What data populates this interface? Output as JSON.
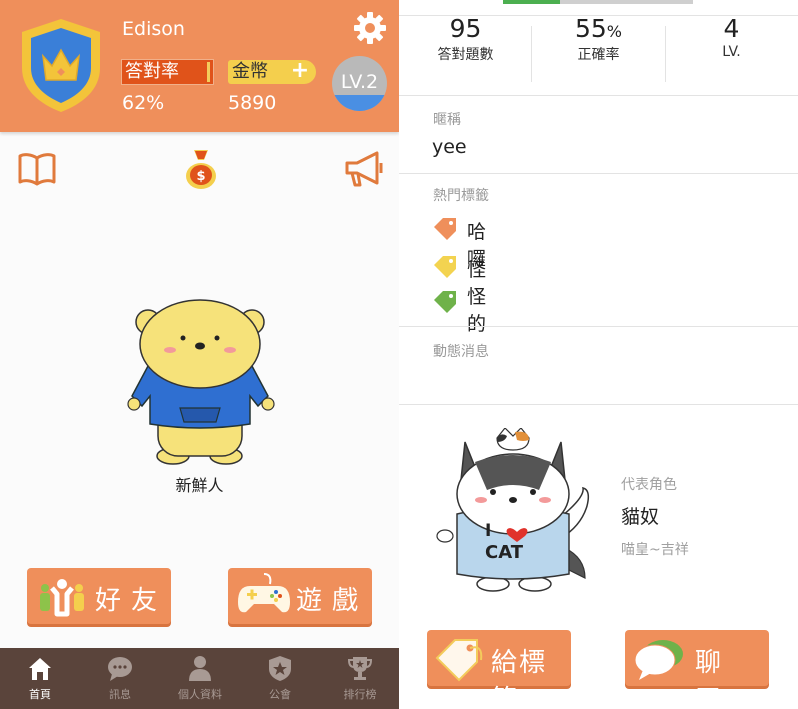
{
  "left": {
    "profile": {
      "username": "Edison",
      "rate_label": "答對率",
      "rate_value": "62%",
      "coin_label": "金幣",
      "coin_plus": "+",
      "coin_value": "5890",
      "level": "LV.2",
      "level_progress": 0.3
    },
    "icons": [
      "book-icon",
      "money-bag-icon",
      "megaphone-icon"
    ],
    "character_label": "新鮮人",
    "buttons": {
      "friends": "好友",
      "games": "遊戲"
    },
    "tabs": [
      {
        "label": "首頁",
        "icon": "home-icon",
        "active": true
      },
      {
        "label": "訊息",
        "icon": "chat-icon",
        "active": false
      },
      {
        "label": "個人資料",
        "icon": "person-icon",
        "active": false
      },
      {
        "label": "公會",
        "icon": "guild-shield-icon",
        "active": false
      },
      {
        "label": "排行榜",
        "icon": "trophy-icon",
        "active": false
      }
    ]
  },
  "right": {
    "progress": 0.3,
    "summary": [
      {
        "value": "95",
        "unit": "",
        "label": "答對題數"
      },
      {
        "value": "55",
        "unit": "%",
        "label": "正確率"
      },
      {
        "value": "4",
        "unit": "",
        "label": "LV."
      }
    ],
    "nickname_title": "暱稱",
    "nickname": "yee",
    "tags_title": "熱門標籤",
    "tags": [
      {
        "text": "哈囉",
        "color": "#ef8f5b"
      },
      {
        "text": "怪怪的",
        "color": "#f3d350"
      },
      {
        "text": "",
        "color": "#6fb24a"
      }
    ],
    "activity_title": "動態消息",
    "character": {
      "label": "代表角色",
      "name": "貓奴",
      "desc": "喵皇~吉祥",
      "shirt_line1": "I",
      "shirt_line2": "CAT"
    },
    "buttons": {
      "give_tag": "給標籤",
      "chat": "聊 天"
    }
  },
  "colors": {
    "accent": "#ef8f5b",
    "tabbar": "#5a443b",
    "rate_box": "#e0531a",
    "coin_box": "#f4cf4d",
    "level_fill": "#4a8fe3"
  }
}
